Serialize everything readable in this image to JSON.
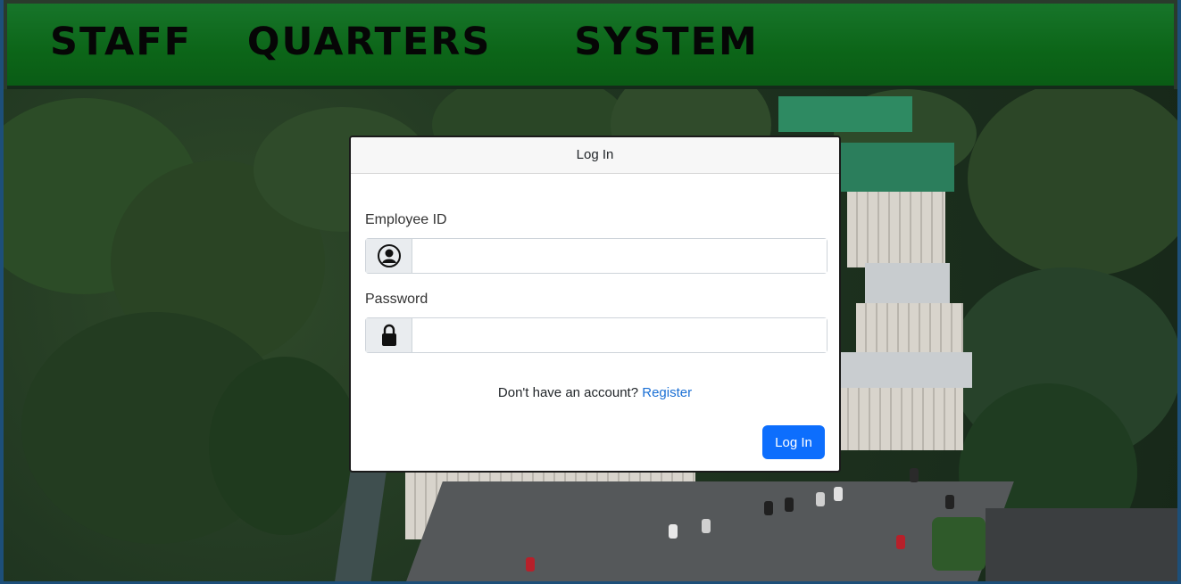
{
  "header": {
    "title": "STAFF  QUARTERS   SYSTEM"
  },
  "login_card": {
    "title": "Log In",
    "employee_id_label": "Employee ID",
    "employee_id_value": "",
    "password_label": "Password",
    "password_value": "",
    "register_prompt": "Don't have an account?",
    "register_link": "Register",
    "submit_label": "Log In"
  },
  "colors": {
    "header_bg": "#0c6518",
    "primary_button": "#0d6efd",
    "link": "#1a6fd4"
  },
  "icons": {
    "employee_id": "user-circle-icon",
    "password": "lock-icon"
  }
}
